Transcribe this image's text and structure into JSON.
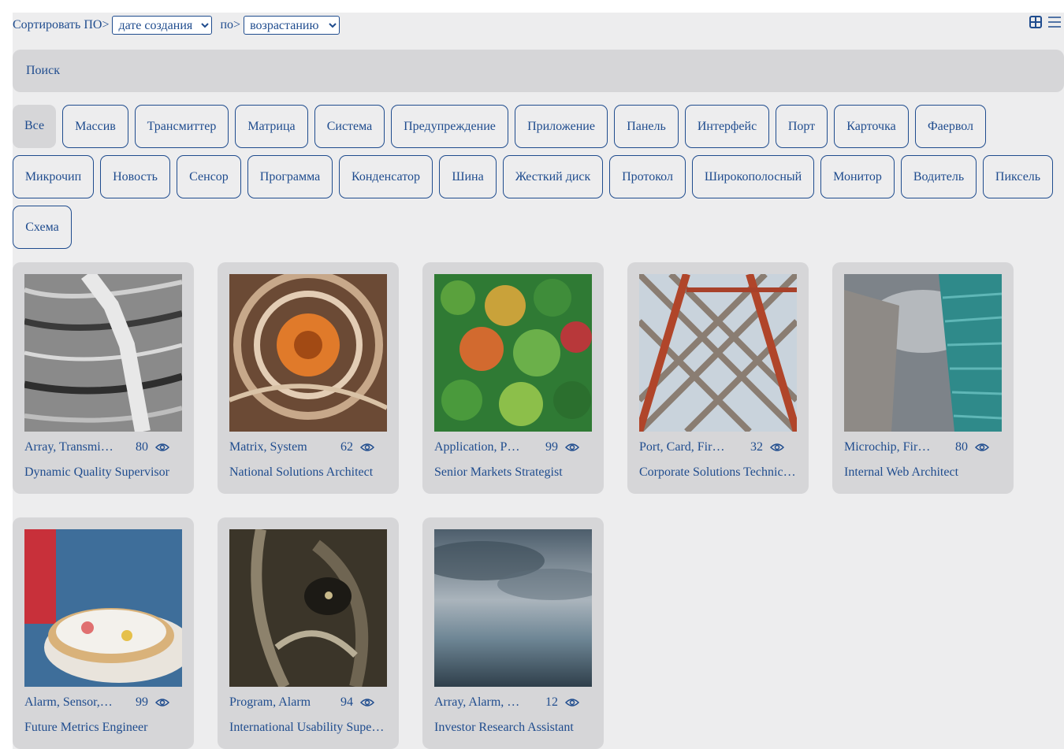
{
  "sort": {
    "label": "Сортировать ПО>",
    "field_value": "дате создания",
    "by_label": "по>",
    "order_value": "возрастанию"
  },
  "view_icons": [
    "grid-view-icon",
    "list-view-icon"
  ],
  "search": {
    "placeholder": "Поиск"
  },
  "chips": [
    "Все",
    "Массив",
    "Трансмиттер",
    "Матрица",
    "Система",
    "Предупреждение",
    "Приложение",
    "Панель",
    "Интерфейс",
    "Порт",
    "Карточка",
    "Фаервол",
    "Микрочип",
    "Новость",
    "Сенсор",
    "Программа",
    "Конденсатор",
    "Шина",
    "Жесткий диск",
    "Протокол",
    "Широкополосный",
    "Монитор",
    "Водитель",
    "Пиксель",
    "Схема"
  ],
  "active_chip": "Все",
  "cards": [
    {
      "tags": "Array, Transmitter",
      "views": "80",
      "name": "Dynamic Quality Supervisor",
      "image": "grey-abstract-lines"
    },
    {
      "tags": "Matrix, System",
      "views": "62",
      "name": "National Solutions Architect",
      "image": "orange-swirl"
    },
    {
      "tags": "Application, Panel",
      "views": "99",
      "name": "Senior Markets Strategist",
      "image": "aerial-forest"
    },
    {
      "tags": "Port, Card, Firewall",
      "views": "32",
      "name": "Corporate Solutions Technician",
      "image": "steel-tower"
    },
    {
      "tags": "Microchip, Firewall",
      "views": "80",
      "name": "Internal Web Architect",
      "image": "skyscrapers"
    },
    {
      "tags": "Alarm, Sensor, Program",
      "views": "99",
      "name": "Future Metrics Engineer",
      "image": "funnel-cake"
    },
    {
      "tags": "Program, Alarm",
      "views": "94",
      "name": "International Usability Supervisor",
      "image": "dark-abstract-face"
    },
    {
      "tags": "Array, Alarm, Scheme",
      "views": "12",
      "name": "Investor Research Assistant",
      "image": "cloudy-sea"
    }
  ],
  "colors": {
    "accent": "#1f4c8e",
    "card_bg": "#d6d6d8",
    "page_bg": "#ededee"
  }
}
